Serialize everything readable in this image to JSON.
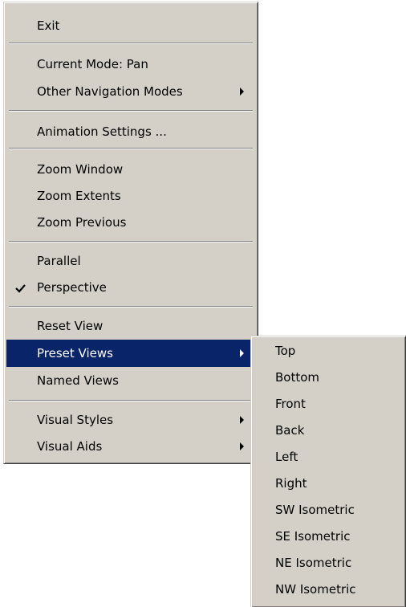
{
  "main_menu": {
    "exit_label": "Exit",
    "current_mode_label": "Current Mode: Pan",
    "other_navigation_modes_label": "Other Navigation Modes",
    "animation_settings_label": "Animation Settings ...",
    "zoom_window_label": "Zoom Window",
    "zoom_extents_label": "Zoom Extents",
    "zoom_previous_label": "Zoom Previous",
    "parallel_label": "Parallel",
    "perspective_label": "Perspective",
    "perspective_checked": true,
    "reset_view_label": "Reset View",
    "preset_views_label": "Preset Views",
    "named_views_label": "Named Views",
    "visual_styles_label": "Visual Styles",
    "visual_aids_label": "Visual Aids"
  },
  "preset_views_submenu": {
    "items": [
      "Top",
      "Bottom",
      "Front",
      "Back",
      "Left",
      "Right",
      "SW Isometric",
      "SE Isometric",
      "NE Isometric",
      "NW Isometric"
    ]
  },
  "colors": {
    "menu_background": "#d4d0c8",
    "highlight": "#0a246a",
    "highlight_text": "#ffffff"
  },
  "icons": {
    "submenu_arrow": "arrow-right-icon",
    "checkmark": "checkmark-icon"
  }
}
